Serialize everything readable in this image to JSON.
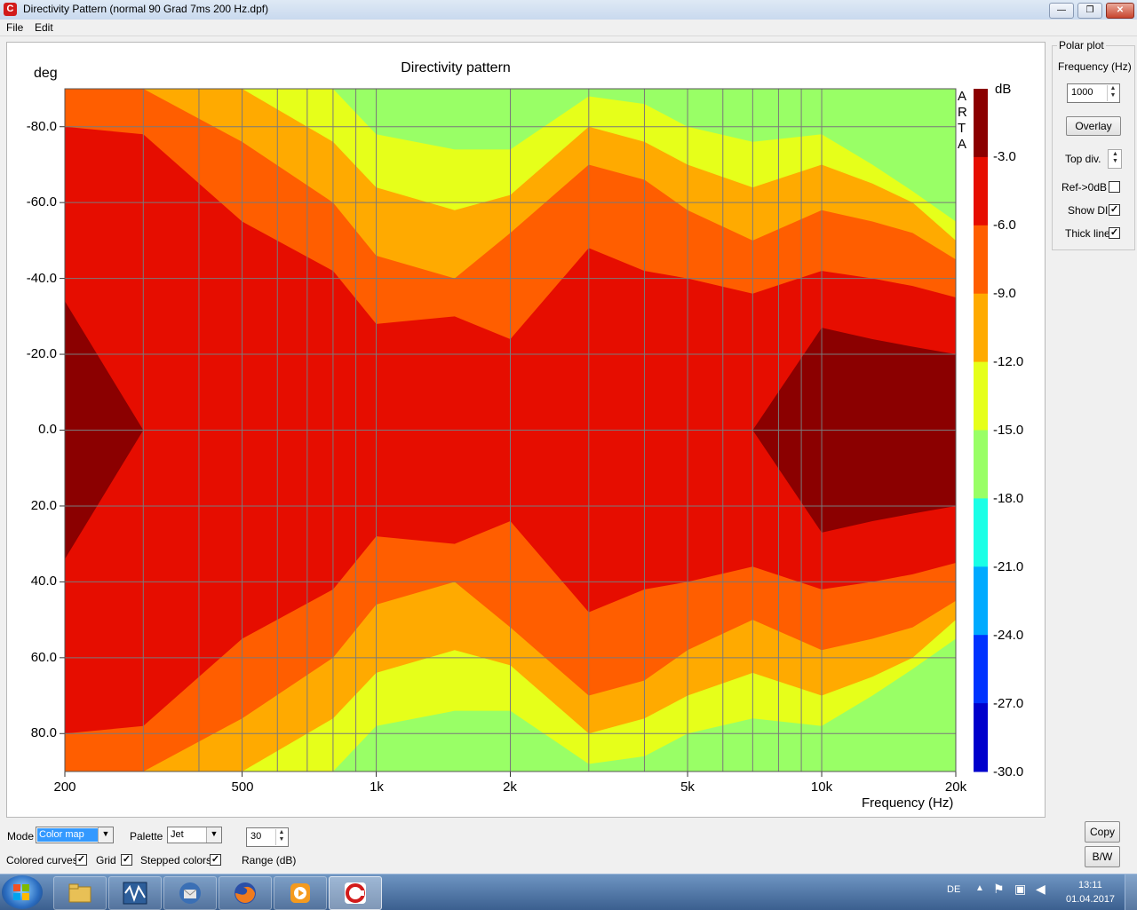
{
  "window": {
    "title": "Directivity Pattern  (normal 90 Grad 7ms 200 Hz.dpf)",
    "app_icon_letter": "C",
    "min_glyph": "—",
    "max_glyph": "❐",
    "close_glyph": "✕"
  },
  "menu": {
    "file": "File",
    "edit": "Edit"
  },
  "plot": {
    "title": "Directivity pattern",
    "y_unit": "deg",
    "x_axis_label": "Frequency (Hz)",
    "colorbar_unit": "dB",
    "arta_letters": [
      "A",
      "R",
      "T",
      "A"
    ],
    "y_ticks": [
      "-80.0",
      "-60.0",
      "-40.0",
      "-20.0",
      "0.0",
      "20.0",
      "40.0",
      "60.0",
      "80.0"
    ],
    "x_ticks": [
      "200",
      "500",
      "1k",
      "2k",
      "5k",
      "10k",
      "20k"
    ],
    "colorbar_ticks": [
      "-3.0",
      "-6.0",
      "-9.0",
      "-12.0",
      "-15.0",
      "-18.0",
      "-21.0",
      "-24.0",
      "-27.0",
      "-30.0"
    ]
  },
  "chart_data": {
    "type": "heatmap",
    "title": "Directivity pattern",
    "xlabel": "Frequency (Hz)",
    "ylabel": "deg",
    "x_scale": "log",
    "xlim": [
      200,
      20000
    ],
    "ylim": [
      -90,
      90
    ],
    "x_ticks": [
      200,
      500,
      1000,
      2000,
      5000,
      10000,
      20000
    ],
    "y_ticks": [
      -80,
      -60,
      -40,
      -20,
      0,
      20,
      40,
      60,
      80
    ],
    "colorbar": {
      "unit": "dB",
      "range": [
        -30,
        0
      ],
      "step": 3,
      "palette": "Jet",
      "levels": [
        {
          "from": -3,
          "to": 0,
          "color": "#8b0000"
        },
        {
          "from": -6,
          "to": -3,
          "color": "#e60d00"
        },
        {
          "from": -9,
          "to": -6,
          "color": "#ff5e00"
        },
        {
          "from": -12,
          "to": -9,
          "color": "#ffaa00"
        },
        {
          "from": -15,
          "to": -12,
          "color": "#e6ff1a"
        },
        {
          "from": -18,
          "to": -15,
          "color": "#99ff66"
        },
        {
          "from": -21,
          "to": -18,
          "color": "#1affe6"
        },
        {
          "from": -24,
          "to": -21,
          "color": "#00aaff"
        },
        {
          "from": -27,
          "to": -24,
          "color": "#0033ff"
        },
        {
          "from": -30,
          "to": -27,
          "color": "#0000cc"
        }
      ]
    },
    "half_beamwidth_deg": {
      "frequencies": [
        200,
        300,
        500,
        800,
        1000,
        1500,
        2000,
        3000,
        4000,
        5000,
        7000,
        10000,
        13000,
        16000,
        20000
      ],
      "-3dB": [
        34,
        0,
        0,
        0,
        0,
        0,
        0,
        0,
        0,
        0,
        0,
        27,
        24,
        22,
        20
      ],
      "-6dB": [
        80,
        78,
        55,
        42,
        28,
        30,
        24,
        48,
        42,
        40,
        36,
        42,
        40,
        38,
        35
      ],
      "-9dB": [
        90,
        90,
        76,
        60,
        46,
        40,
        52,
        70,
        66,
        58,
        50,
        58,
        55,
        52,
        45
      ],
      "-12dB": [
        90,
        90,
        90,
        76,
        64,
        58,
        62,
        80,
        76,
        70,
        64,
        70,
        65,
        60,
        50
      ],
      "-15dB": [
        90,
        90,
        90,
        90,
        78,
        74,
        74,
        88,
        86,
        80,
        76,
        78,
        70,
        63,
        55
      ]
    }
  },
  "polar": {
    "group_title": "Polar plot",
    "frequency_label": "Frequency (Hz)",
    "frequency_value": "1000",
    "overlay_label": "Overlay",
    "top_div_label": "Top div.",
    "ref_label": "Ref->0dB",
    "ref_checked": false,
    "show_di_label": "Show DI",
    "show_di_checked": true,
    "thick_line_label": "Thick line",
    "thick_line_checked": true
  },
  "bottom": {
    "mode_label": "Mode",
    "mode_value": "Color map",
    "palette_label": "Palette",
    "palette_value": "Jet",
    "range_value": "30",
    "range_label": "Range (dB)",
    "colored_curves_label": "Colored curves",
    "colored_curves_checked": true,
    "grid_label": "Grid",
    "grid_checked": true,
    "stepped_label": "Stepped colors",
    "stepped_checked": true,
    "copy_label": "Copy",
    "bw_label": "B/W"
  },
  "taskbar": {
    "language": "DE",
    "time": "13:11",
    "date": "01.04.2017"
  }
}
